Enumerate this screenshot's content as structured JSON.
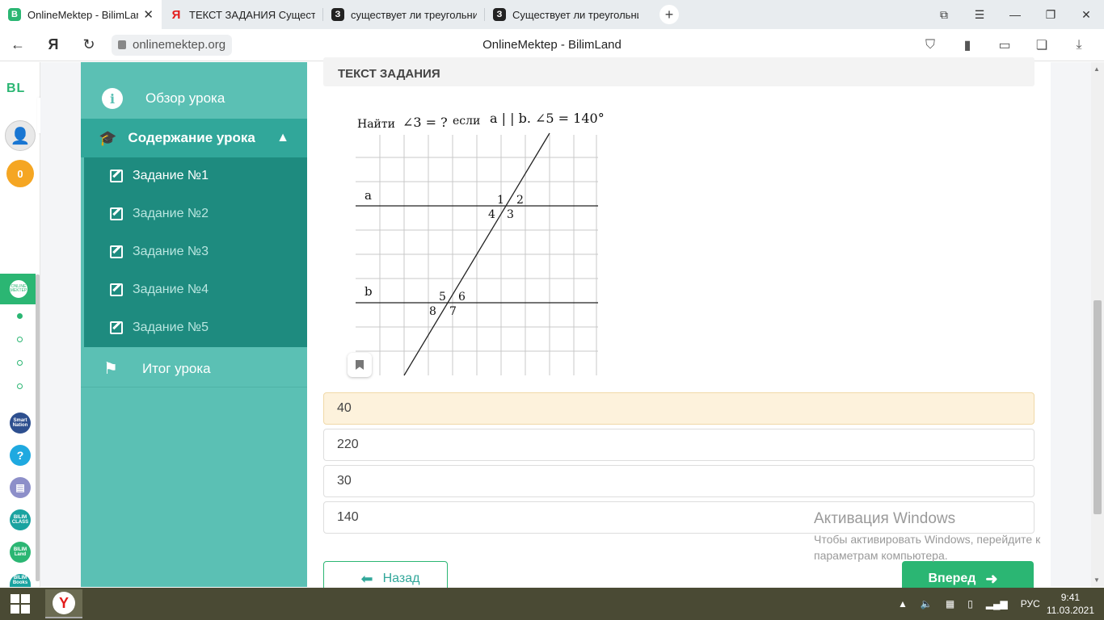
{
  "tabs": [
    {
      "label": "OnlineMektep - BilimLand",
      "favicon": "B",
      "color": "#2bb673",
      "active": true
    },
    {
      "label": "ТЕКСТ ЗАДАНИЯ Существ",
      "favicon": "Я",
      "color": "#e31b1b",
      "active": false
    },
    {
      "label": "существует ли треугольни",
      "favicon": "З",
      "color": "#222222",
      "active": false
    },
    {
      "label": "Существует ли треугольни",
      "favicon": "З",
      "color": "#222222",
      "active": false
    }
  ],
  "window_controls": {
    "minimize": "—",
    "maximize": "❐",
    "close": "✕"
  },
  "address": {
    "url": "onlinemektep.org",
    "title": "OnlineMektep - BilimLand"
  },
  "rail": {
    "logo": "BL",
    "coins": "0",
    "onlinemektep": "ONLINE MEKTEP",
    "apps": [
      {
        "text": "Smart Nation",
        "color": "#2d4f8f"
      },
      {
        "text": "?",
        "color": "#1fa9e0"
      },
      {
        "text": "▤",
        "color": "#8d8fc9"
      },
      {
        "text": "BILIM CLASS",
        "color": "#1aa3a0"
      },
      {
        "text": "BILIM Land",
        "color": "#2bb673"
      },
      {
        "text": "BILIM Books",
        "color": "#1aa3a0"
      }
    ]
  },
  "lesson": {
    "overview": "Обзор урока",
    "content": "Содержание урока",
    "tasks": [
      "Задание №1",
      "Задание №2",
      "Задание №3",
      "Задание №4",
      "Задание №5"
    ],
    "summary": "Итог урока"
  },
  "task": {
    "header": "ТЕКСТ ЗАДАНИЯ",
    "prompt_find": "Найти",
    "prompt_angle": "∠3 = ?",
    "prompt_if": "если",
    "prompt_cond": "a | | b. ∠5 = 140°",
    "line_a": "a",
    "line_b": "b",
    "angles_top": [
      "1",
      "2",
      "4",
      "3"
    ],
    "angles_bottom": [
      "5",
      "6",
      "8",
      "7"
    ]
  },
  "answers": [
    "40",
    "220",
    "30",
    "140"
  ],
  "selected_answer": 0,
  "buttons": {
    "back": "Назад",
    "next": "Вперед"
  },
  "watermark": {
    "title": "Активация Windows",
    "line1": "Чтобы активировать Windows, перейдите к",
    "line2": "параметрам компьютера."
  },
  "taskbar": {
    "lang": "РУС",
    "time": "9:41",
    "date": "11.03.2021"
  }
}
